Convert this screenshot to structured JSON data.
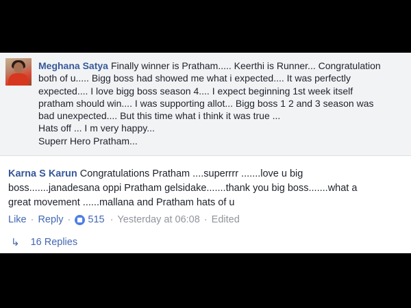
{
  "comment1": {
    "author": "Meghana Satya",
    "lines": [
      "Finally winner is Pratham..... Keerthi is Runner... Congratulation",
      "both of u..... Bigg boss had showed me what i expected.... It was perfectly",
      "expected.... I love bigg boss season 4.... I expect beginning 1st week itself",
      "pratham should win.... I was supporting allot... Bigg boss 1 2 and 3 season was",
      "bad unexpected.... But this time what i think it was true ...",
      "Hats off ... I m very happy...",
      "Superr Hero Pratham..."
    ]
  },
  "comment2": {
    "author": "Karna S Karun",
    "lines": [
      "Congratulations Pratham ....superrrr .......love u big",
      "boss.......janadesana oppi Pratham gelsidake.......thank you big boss.......what a",
      "great movement ......mallana and Pratham hats of u"
    ],
    "actions": {
      "like": "Like",
      "reply": "Reply",
      "reaction_count": "515",
      "timestamp": "Yesterday at 06:08",
      "edited": "Edited"
    },
    "replies_label": "16 Replies"
  },
  "icons": {
    "reaction": "like-reaction-icon",
    "reply_arrow": "reply-arrow-icon"
  }
}
